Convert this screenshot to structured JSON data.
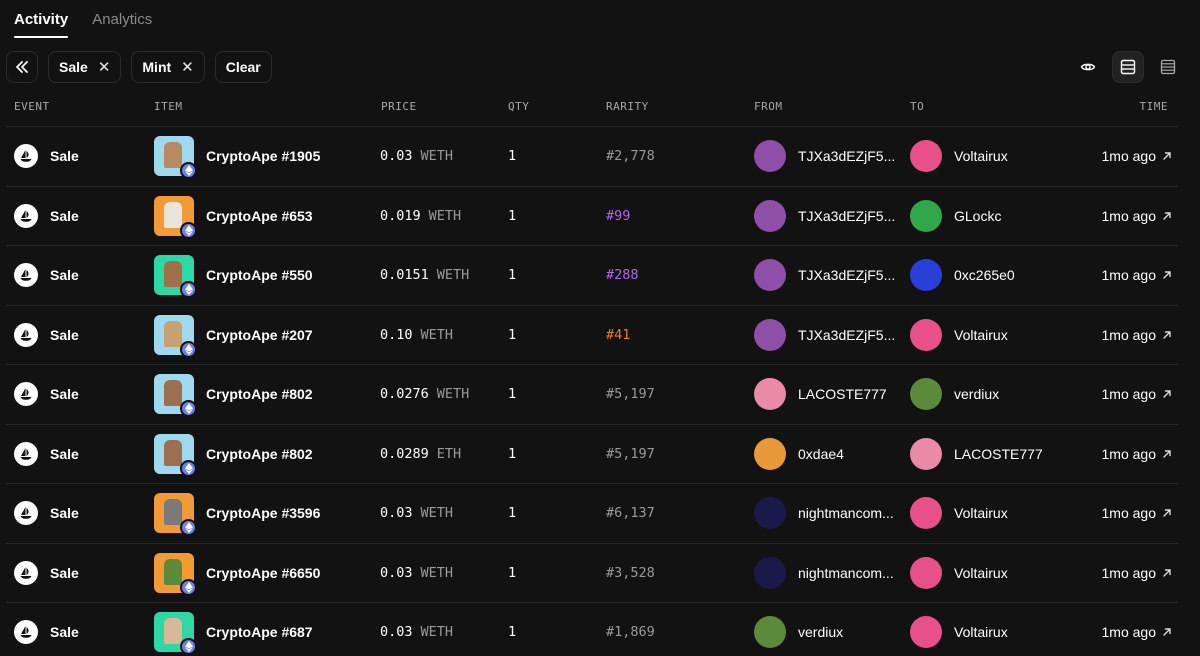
{
  "tabs": [
    {
      "label": "Activity",
      "active": true
    },
    {
      "label": "Analytics",
      "active": false
    }
  ],
  "filters": {
    "collapse_icon": "double-chevron-left-icon",
    "chips": [
      {
        "label": "Sale",
        "icon": "close-icon"
      },
      {
        "label": "Mint",
        "icon": "close-icon"
      }
    ],
    "clear_label": "Clear"
  },
  "view_controls": {
    "eye_icon": "eye-icon",
    "list_icon": "list-view-icon",
    "compact_icon": "compact-list-icon"
  },
  "columns": {
    "event": "EVENT",
    "item": "ITEM",
    "price": "PRICE",
    "qty": "QTY",
    "rarity": "RARITY",
    "from": "FROM",
    "to": "TO",
    "time": "TIME"
  },
  "rarity_colors": {
    "default": "#9a9a9a",
    "purple": "#b065e8",
    "orange": "#f07a2a"
  },
  "rows": [
    {
      "event": "Sale",
      "item": "CryptoApe #1905",
      "thumb_bg": "#9fd9ef",
      "ape_color": "#b88a62",
      "price": "0.03",
      "unit": "WETH",
      "qty": "1",
      "rarity": "#2,778",
      "rarity_color": "default",
      "from": "TJXa3dEZjF5...",
      "from_avatar": "#8e4fa8",
      "to": "Voltairux",
      "to_avatar": "#e8508a"
    },
    {
      "event": "Sale",
      "item": "CryptoApe #653",
      "thumb_bg": "#f29a36",
      "ape_color": "#e8e4dc",
      "price": "0.019",
      "unit": "WETH",
      "qty": "1",
      "rarity": "#99",
      "rarity_color": "purple",
      "from": "TJXa3dEZjF5...",
      "from_avatar": "#8e4fa8",
      "to": "GLockc",
      "to_avatar": "#2ea84a"
    },
    {
      "event": "Sale",
      "item": "CryptoApe #550",
      "thumb_bg": "#2fd6a6",
      "ape_color": "#a0704a",
      "price": "0.0151",
      "unit": "WETH",
      "qty": "1",
      "rarity": "#288",
      "rarity_color": "purple",
      "from": "TJXa3dEZjF5...",
      "from_avatar": "#8e4fa8",
      "to": "0xc265e0",
      "to_avatar": "#2a3fd8"
    },
    {
      "event": "Sale",
      "item": "CryptoApe #207",
      "thumb_bg": "#9fd9ef",
      "ape_color": "#c9a070",
      "price": "0.10",
      "unit": "WETH",
      "qty": "1",
      "rarity": "#41",
      "rarity_color": "orange",
      "from": "TJXa3dEZjF5...",
      "from_avatar": "#8e4fa8",
      "to": "Voltairux",
      "to_avatar": "#e8508a"
    },
    {
      "event": "Sale",
      "item": "CryptoApe #802",
      "thumb_bg": "#9fd9ef",
      "ape_color": "#9a7050",
      "price": "0.0276",
      "unit": "WETH",
      "qty": "1",
      "rarity": "#5,197",
      "rarity_color": "default",
      "from": "LACOSTE777",
      "from_avatar": "#e88aa8",
      "to": "verdiux",
      "to_avatar": "#5a8a3a"
    },
    {
      "event": "Sale",
      "item": "CryptoApe #802",
      "thumb_bg": "#9fd9ef",
      "ape_color": "#9a7050",
      "price": "0.0289",
      "unit": "ETH",
      "qty": "1",
      "rarity": "#5,197",
      "rarity_color": "default",
      "from": "0xdae4",
      "from_avatar": "#e89a3a",
      "to": "LACOSTE777",
      "to_avatar": "#e88aa8"
    },
    {
      "event": "Sale",
      "item": "CryptoApe #3596",
      "thumb_bg": "#f29a36",
      "ape_color": "#7a7a7a",
      "price": "0.03",
      "unit": "WETH",
      "qty": "1",
      "rarity": "#6,137",
      "rarity_color": "default",
      "from": "nightmancom...",
      "from_avatar": "#1a1a4a",
      "to": "Voltairux",
      "to_avatar": "#e8508a"
    },
    {
      "event": "Sale",
      "item": "CryptoApe #6650",
      "thumb_bg": "#f29a36",
      "ape_color": "#5a8a3a",
      "price": "0.03",
      "unit": "WETH",
      "qty": "1",
      "rarity": "#3,528",
      "rarity_color": "default",
      "from": "nightmancom...",
      "from_avatar": "#1a1a4a",
      "to": "Voltairux",
      "to_avatar": "#e8508a"
    },
    {
      "event": "Sale",
      "item": "CryptoApe #687",
      "thumb_bg": "#2fd6a6",
      "ape_color": "#d8b898",
      "price": "0.03",
      "unit": "WETH",
      "qty": "1",
      "rarity": "#1,869",
      "rarity_color": "default",
      "from": "verdiux",
      "from_avatar": "#5a8a3a",
      "to": "Voltairux",
      "to_avatar": "#e8508a"
    }
  ],
  "time_label": "1mo ago"
}
